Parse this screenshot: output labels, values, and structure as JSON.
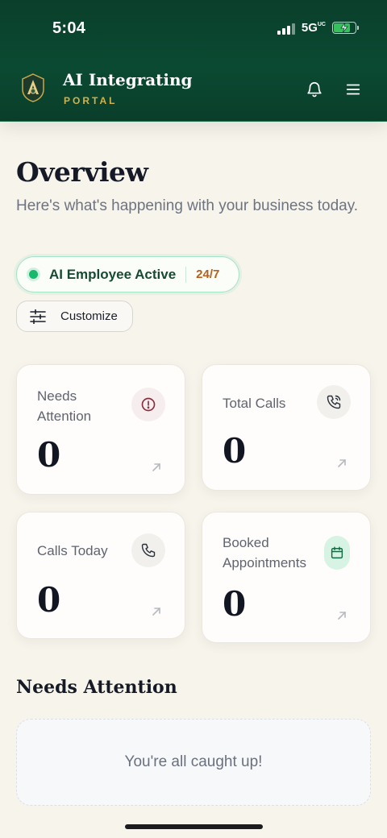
{
  "status_bar": {
    "time": "5:04",
    "network": "5G",
    "network_sup": "UC"
  },
  "header": {
    "brand_title": "AI Integrating",
    "brand_subtitle": "PORTAL",
    "icons": [
      "bell-icon",
      "menu-icon"
    ]
  },
  "overview": {
    "title": "Overview",
    "subtitle": "Here's what's happening with your business today."
  },
  "status_pill": {
    "label": "AI Employee Active",
    "hours": "24/7",
    "color": "#19b86a"
  },
  "customize": {
    "label": "Customize"
  },
  "stats": [
    {
      "label": "Needs Attention",
      "value": "0",
      "icon": "alert-circle-icon"
    },
    {
      "label": "Total Calls",
      "value": "0",
      "icon": "phone-call-icon"
    },
    {
      "label": "Calls Today",
      "value": "0",
      "icon": "phone-icon"
    },
    {
      "label": "Booked Appointments",
      "value": "0",
      "icon": "calendar-icon"
    }
  ],
  "needs_attention": {
    "title": "Needs Attention",
    "empty_message": "You're all caught up!"
  },
  "colors": {
    "header_bg": "#0b4a32",
    "accent_gold": "#d4b24a",
    "active_green": "#19b86a",
    "hours_orange": "#b5601e",
    "page_bg": "#f7f4ec"
  }
}
